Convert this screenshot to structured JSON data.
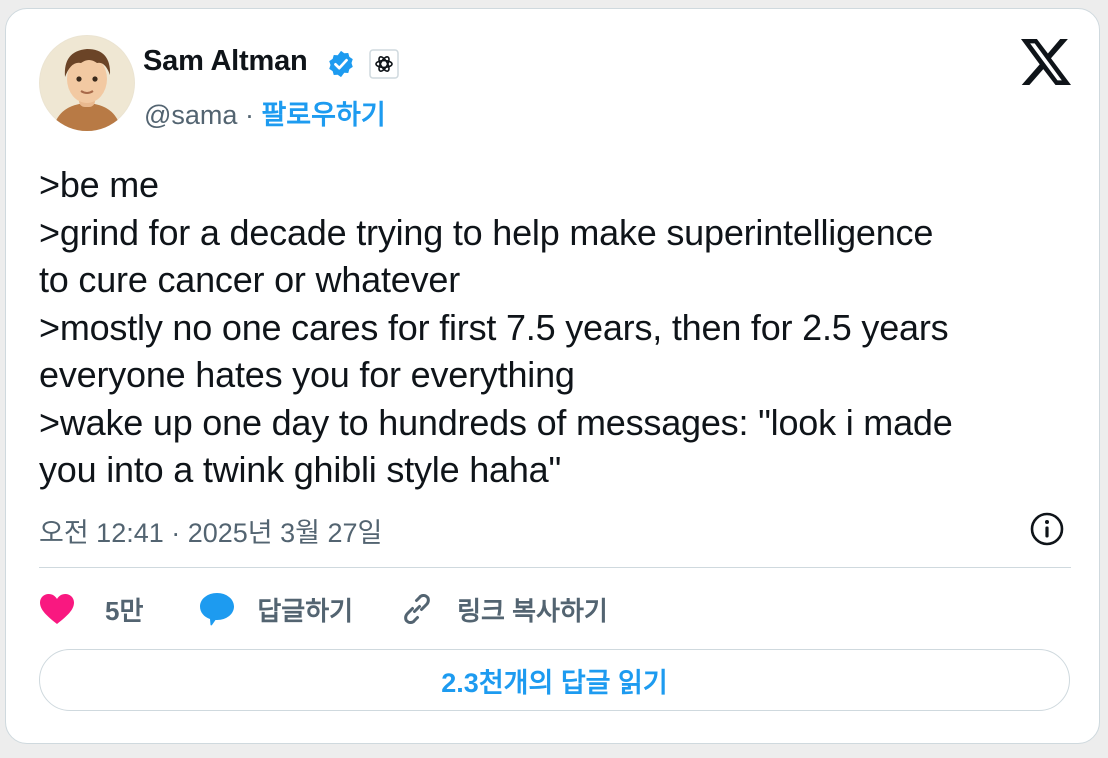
{
  "author": {
    "name": "Sam Altman",
    "handle": "@sama",
    "separator": "·",
    "follow_label": "팔로우하기"
  },
  "icons": {
    "avatar": "avatar",
    "verified": "verified-badge-icon",
    "affiliate": "openai-logo-icon",
    "platform": "x-logo-icon",
    "info": "info-icon",
    "like": "heart-icon",
    "reply": "speech-bubble-icon",
    "copy_link": "link-icon"
  },
  "tweet": {
    "lines": [
      ">be me",
      ">grind for a decade trying to help make superintelligence",
      "to cure cancer or whatever",
      ">mostly no one cares for first 7.5 years, then for 2.5 years",
      "everyone hates you for everything",
      ">wake up one day to hundreds of messages: \"look i made",
      "you into a twink ghibli style haha\""
    ],
    "timestamp": "오전 12:41 · 2025년 3월 27일"
  },
  "actions": {
    "like_count": "5만",
    "reply_label": "답글하기",
    "copy_link_label": "링크 복사하기"
  },
  "read_replies_label": "2.3천개의 답글 읽기",
  "colors": {
    "accent": "#1d9bf0",
    "like": "#f91880",
    "text": "#0f1419",
    "secondary": "#536471",
    "border": "#cfd9de"
  }
}
